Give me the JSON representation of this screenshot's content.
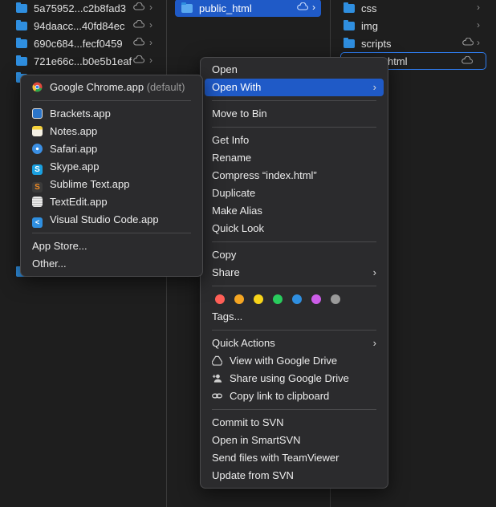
{
  "finder": {
    "col1_items": [
      {
        "name": "5a75952...c2b8fad3"
      },
      {
        "name": "94daacc...40fd84ec"
      },
      {
        "name": "690c684...fecf0459"
      },
      {
        "name": "721e66c...b0e5b1eaf"
      }
    ],
    "col2_selected": "public_html",
    "col3_items": [
      {
        "name": "css"
      },
      {
        "name": "img"
      },
      {
        "name": "scripts"
      },
      {
        "name": "index.html",
        "visible_text": "html"
      }
    ]
  },
  "open_with_menu": {
    "default_app": {
      "label": "Google Chrome.app",
      "suffix": "(default)"
    },
    "apps": [
      {
        "label": "Brackets.app",
        "icon": "brackets-icon",
        "color": "#2b75c9"
      },
      {
        "label": "Notes.app",
        "icon": "notes-icon",
        "color": "#f5d23c"
      },
      {
        "label": "Safari.app",
        "icon": "safari-icon",
        "color": "#3b8fe3"
      },
      {
        "label": "Skype.app",
        "icon": "skype-icon",
        "color": "#1aa0e0"
      },
      {
        "label": "Sublime Text.app",
        "icon": "sublime-icon",
        "color": "#f08a24"
      },
      {
        "label": "TextEdit.app",
        "icon": "textedit-icon",
        "color": "#e9e9e9"
      },
      {
        "label": "Visual Studio Code.app",
        "icon": "vscode-icon",
        "color": "#2f8fe0"
      }
    ],
    "app_store": "App Store...",
    "other": "Other..."
  },
  "context_menu": {
    "open": "Open",
    "open_with": "Open With",
    "move_to_bin": "Move to Bin",
    "get_info": "Get Info",
    "rename": "Rename",
    "compress": "Compress “index.html”",
    "duplicate": "Duplicate",
    "make_alias": "Make Alias",
    "quick_look": "Quick Look",
    "copy": "Copy",
    "share": "Share",
    "tag_colors": [
      "#ff5f57",
      "#f5a623",
      "#f8d41a",
      "#29cc5d",
      "#2f8fe0",
      "#cc5de8",
      "#9a9a9a"
    ],
    "tags": "Tags...",
    "quick_actions": "Quick Actions",
    "view_google_drive": "View with Google Drive",
    "share_google_drive": "Share using Google Drive",
    "copy_link": "Copy link to clipboard",
    "commit_svn": "Commit to SVN",
    "open_smartsvn": "Open in SmartSVN",
    "send_teamviewer": "Send files with TeamViewer",
    "update_svn": "Update from SVN"
  }
}
